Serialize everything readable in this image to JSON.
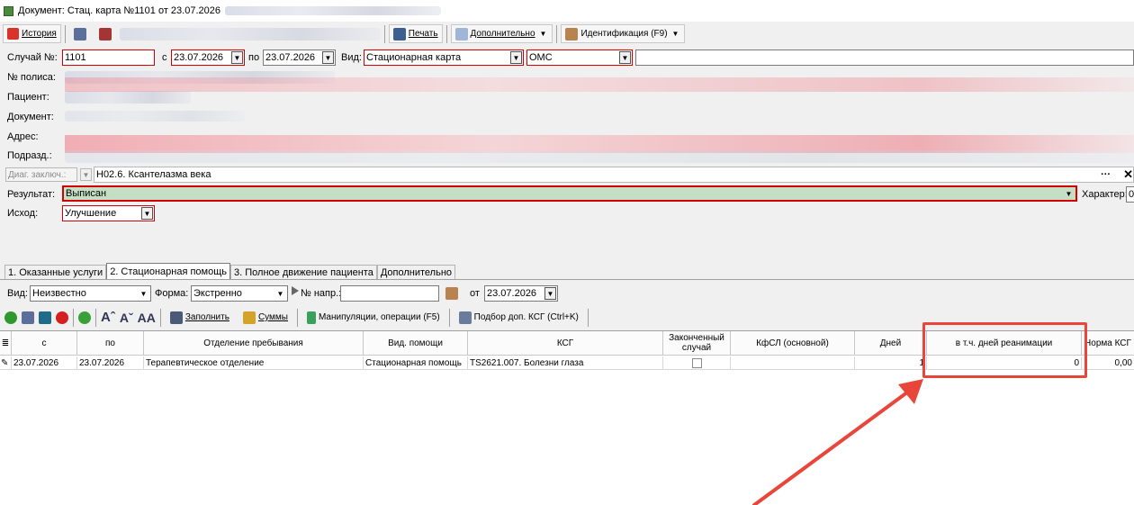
{
  "window": {
    "title": "Документ: Стац. карта №1101 от 23.07.2026"
  },
  "toolbar": {
    "history_label": "История",
    "print_label": "Печать",
    "additional_label": "Дополнительно",
    "identification_label": "Идентификация (F9)"
  },
  "case": {
    "number_label": "Случай №:",
    "number_value": "1101",
    "from_label": "с",
    "from_date": "23.07.2026",
    "to_label": "по",
    "to_date": "23.07.2026",
    "kind_label": "Вид:",
    "kind_value": "Стационарная карта",
    "payment_value": "ОМС"
  },
  "patient_labels": {
    "policy": "№ полиса:",
    "patient": "Пациент:",
    "document": "Документ:",
    "address": "Адрес:",
    "department": "Подразд.:"
  },
  "diagnosis": {
    "label": "Диаг. заключ.:",
    "value": "H02.6. Ксантелазма века"
  },
  "result": {
    "label": "Результат:",
    "value": "Выписан",
    "character_label": "Характер:",
    "character_value": "0"
  },
  "outcome": {
    "label": "Исход:",
    "value": "Улучшение"
  },
  "tabs": [
    {
      "label": "1. Оказанные услуги"
    },
    {
      "label": "2. Стационарная помощь"
    },
    {
      "label": "3. Полное движение пациента"
    },
    {
      "label": "Дополнительно"
    }
  ],
  "filters": {
    "kind_label": "Вид:",
    "kind_value": "Неизвестно",
    "form_label": "Форма:",
    "form_value": "Экстренно",
    "referral_label": "№ напр.:",
    "referral_value": "",
    "from_label": "от",
    "from_date": "23.07.2026"
  },
  "grid_toolbar": {
    "fill_label": "Заполнить",
    "sums_label": "Суммы",
    "manipulations_label": "Манипуляции, операции (F5)",
    "ksg_select_label": "Подбор доп. КСГ (Ctrl+K)"
  },
  "grid": {
    "columns": [
      "с",
      "по",
      "Отделение пребывания",
      "Вид. помощи",
      "КСГ",
      "Законченный случай",
      "КфСЛ (основной)",
      "Дней",
      "в т.ч. дней реанимации",
      "Норма КСГ"
    ],
    "rows": [
      {
        "from": "23.07.2026",
        "to": "23.07.2026",
        "department": "Терапевтическое отделение",
        "care_type": "Стационарная помощь",
        "ksg": "TS2621.007. Болезни глаза",
        "completed": "",
        "kfsl": "",
        "days": "1",
        "reanimation_days": "0",
        "ksg_norm": "0,00"
      }
    ]
  },
  "colors": {
    "highlight": "#e8463a",
    "result_bg": "#c4dfc4",
    "required_border": "#d40000"
  }
}
